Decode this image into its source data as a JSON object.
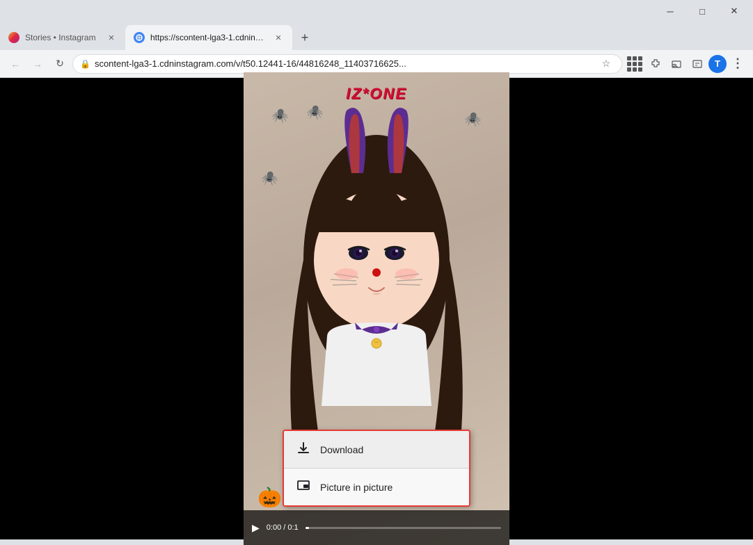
{
  "browser": {
    "title_bar": {
      "minimize_label": "─",
      "maximize_label": "□",
      "close_label": "✕"
    },
    "tabs": [
      {
        "id": "tab1",
        "title": "Stories • Instagram",
        "favicon": "instagram",
        "active": false,
        "close_label": "✕"
      },
      {
        "id": "tab2",
        "title": "https://scontent-lga3-1.cdninsta...",
        "favicon": "globe",
        "active": true,
        "close_label": "✕"
      }
    ],
    "new_tab_label": "+",
    "nav": {
      "back_label": "←",
      "forward_label": "→",
      "reload_label": "↻"
    },
    "address_bar": {
      "lock_icon": "🔒",
      "url": "scontent-lga3-1.cdninstagram.com/v/t50.12441-16/44816248_11403716625...",
      "star_icon": "☆"
    },
    "toolbar": {
      "extensions_icon": "⧉",
      "cast_icon": "⊡",
      "more_icon": "⋮",
      "profile_label": "T"
    }
  },
  "video": {
    "izzone_logo": "IZ*ONE",
    "time_current": "0:00",
    "time_total": "0:1",
    "play_icon": "▶"
  },
  "context_menu": {
    "items": [
      {
        "id": "download",
        "label": "Download",
        "icon": "download"
      },
      {
        "id": "pip",
        "label": "Picture in picture",
        "icon": "pip"
      }
    ]
  },
  "colors": {
    "accent_red": "#e53935",
    "chrome_bg": "#dee1e6",
    "tab_active_bg": "#f1f3f4",
    "address_bg": "#ffffff",
    "profile_blue": "#1a73e8"
  }
}
